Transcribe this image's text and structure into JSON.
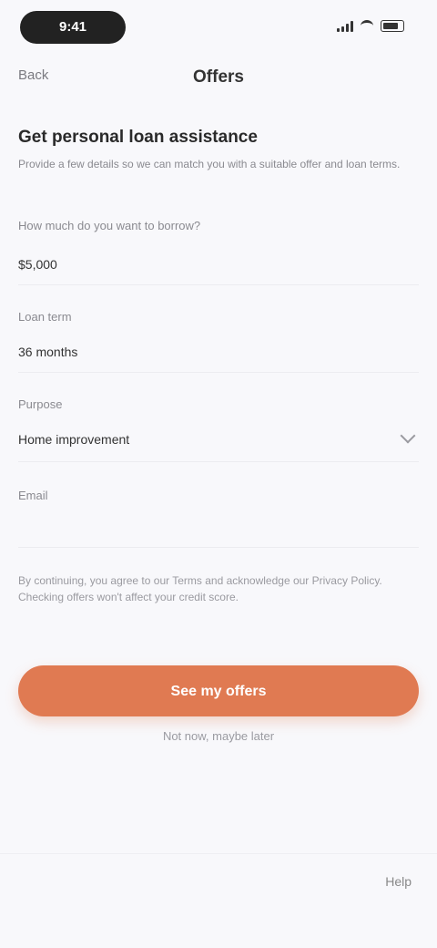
{
  "status": {
    "time": "9:41"
  },
  "nav": {
    "back_label": "Back",
    "title": "Offers"
  },
  "main": {
    "heading": "Get personal loan assistance",
    "description": "Provide a few details so we can match you with a suitable offer and loan terms."
  },
  "fields": [
    {
      "label": "How much do you want to borrow?",
      "value": "$5,000"
    },
    {
      "label": "Loan term",
      "value": "36 months"
    },
    {
      "label": "Purpose",
      "value": "Home improvement"
    },
    {
      "label": "Email",
      "value": ""
    }
  ],
  "disclaimer": "By continuing, you agree to our Terms and acknowledge our Privacy Policy. Checking offers won't affect your credit score.",
  "cta": {
    "label": "See my offers"
  },
  "secondary_link": "Not now, maybe later",
  "bottom": {
    "action_label": "Help"
  },
  "colors": {
    "accent": "#e07a52",
    "background": "#f8f8fb"
  }
}
